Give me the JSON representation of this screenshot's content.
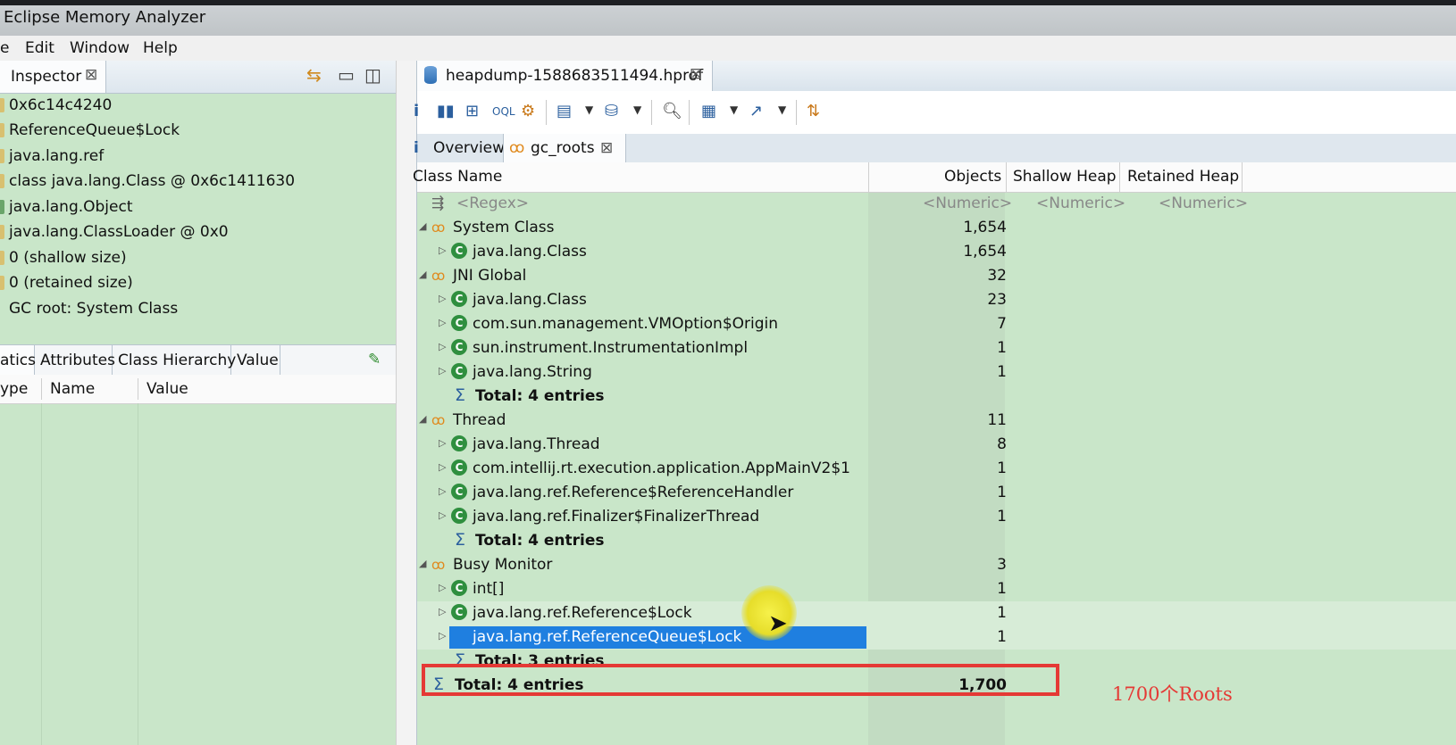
{
  "window": {
    "title": "Eclipse Memory Analyzer"
  },
  "menu": [
    "e",
    "Edit",
    "Window",
    "Help"
  ],
  "inspector": {
    "tab_label": "Inspector",
    "rows": [
      "0x6c14c4240",
      "ReferenceQueue$Lock",
      "java.lang.ref",
      "class java.lang.Class @ 0x6c1411630",
      "java.lang.Object",
      "java.lang.ClassLoader @ 0x0",
      "0 (shallow size)",
      "0 (retained size)",
      "GC root: System Class"
    ],
    "tabs": [
      "atics",
      "Attributes",
      "Class Hierarchy",
      "Value"
    ],
    "columns": [
      "ype",
      "Name",
      "Value"
    ]
  },
  "editor": {
    "tab_label": "heapdump-1588683511494.hprof",
    "subtabs": {
      "overview": "Overview",
      "gc_roots": "gc_roots"
    },
    "columns": {
      "class_name": "Class Name",
      "objects": "Objects",
      "shallow": "Shallow Heap",
      "retained": "Retained Heap"
    },
    "filter": {
      "regex": "<Regex>",
      "numeric": "<Numeric>"
    },
    "rows": [
      {
        "level": 0,
        "kind": "group",
        "name": "System Class",
        "objects": "1,654"
      },
      {
        "level": 1,
        "kind": "class",
        "name": "java.lang.Class",
        "objects": "1,654"
      },
      {
        "level": 0,
        "kind": "group",
        "name": "JNI Global",
        "objects": "32"
      },
      {
        "level": 1,
        "kind": "class",
        "name": "java.lang.Class",
        "objects": "23"
      },
      {
        "level": 1,
        "kind": "class",
        "name": "com.sun.management.VMOption$Origin",
        "objects": "7"
      },
      {
        "level": 1,
        "kind": "class",
        "name": "sun.instrument.InstrumentationImpl",
        "objects": "1"
      },
      {
        "level": 1,
        "kind": "class",
        "name": "java.lang.String",
        "objects": "1"
      },
      {
        "level": 1,
        "kind": "total",
        "name": "Total: 4 entries",
        "objects": ""
      },
      {
        "level": 0,
        "kind": "group",
        "name": "Thread",
        "objects": "11"
      },
      {
        "level": 1,
        "kind": "class",
        "name": "java.lang.Thread",
        "objects": "8"
      },
      {
        "level": 1,
        "kind": "class",
        "name": "com.intellij.rt.execution.application.AppMainV2$1",
        "objects": "1"
      },
      {
        "level": 1,
        "kind": "class",
        "name": "java.lang.ref.Reference$ReferenceHandler",
        "objects": "1"
      },
      {
        "level": 1,
        "kind": "class",
        "name": "java.lang.ref.Finalizer$FinalizerThread",
        "objects": "1"
      },
      {
        "level": 1,
        "kind": "total",
        "name": "Total: 4 entries",
        "objects": ""
      },
      {
        "level": 0,
        "kind": "group",
        "name": "Busy Monitor",
        "objects": "3"
      },
      {
        "level": 1,
        "kind": "class",
        "name": "int[]",
        "objects": "1"
      },
      {
        "level": 1,
        "kind": "class",
        "name": "java.lang.ref.Reference$Lock",
        "objects": "1"
      },
      {
        "level": 1,
        "kind": "class",
        "name": "java.lang.ref.ReferenceQueue$Lock",
        "objects": "1",
        "selected": true
      },
      {
        "level": 1,
        "kind": "total",
        "name": "Total: 3 entries",
        "objects": ""
      },
      {
        "level": 0,
        "kind": "grandtotal",
        "name": "Total: 4 entries",
        "objects": "1,700"
      }
    ]
  },
  "annotation": {
    "note": "1700个Roots",
    "highlight_color": "#e53935"
  },
  "colors": {
    "panel_bg": "#c9e6c9",
    "selection": "#1f7fe0",
    "class_icon": "#2f8f3f",
    "group_icon": "#e08a1e"
  }
}
